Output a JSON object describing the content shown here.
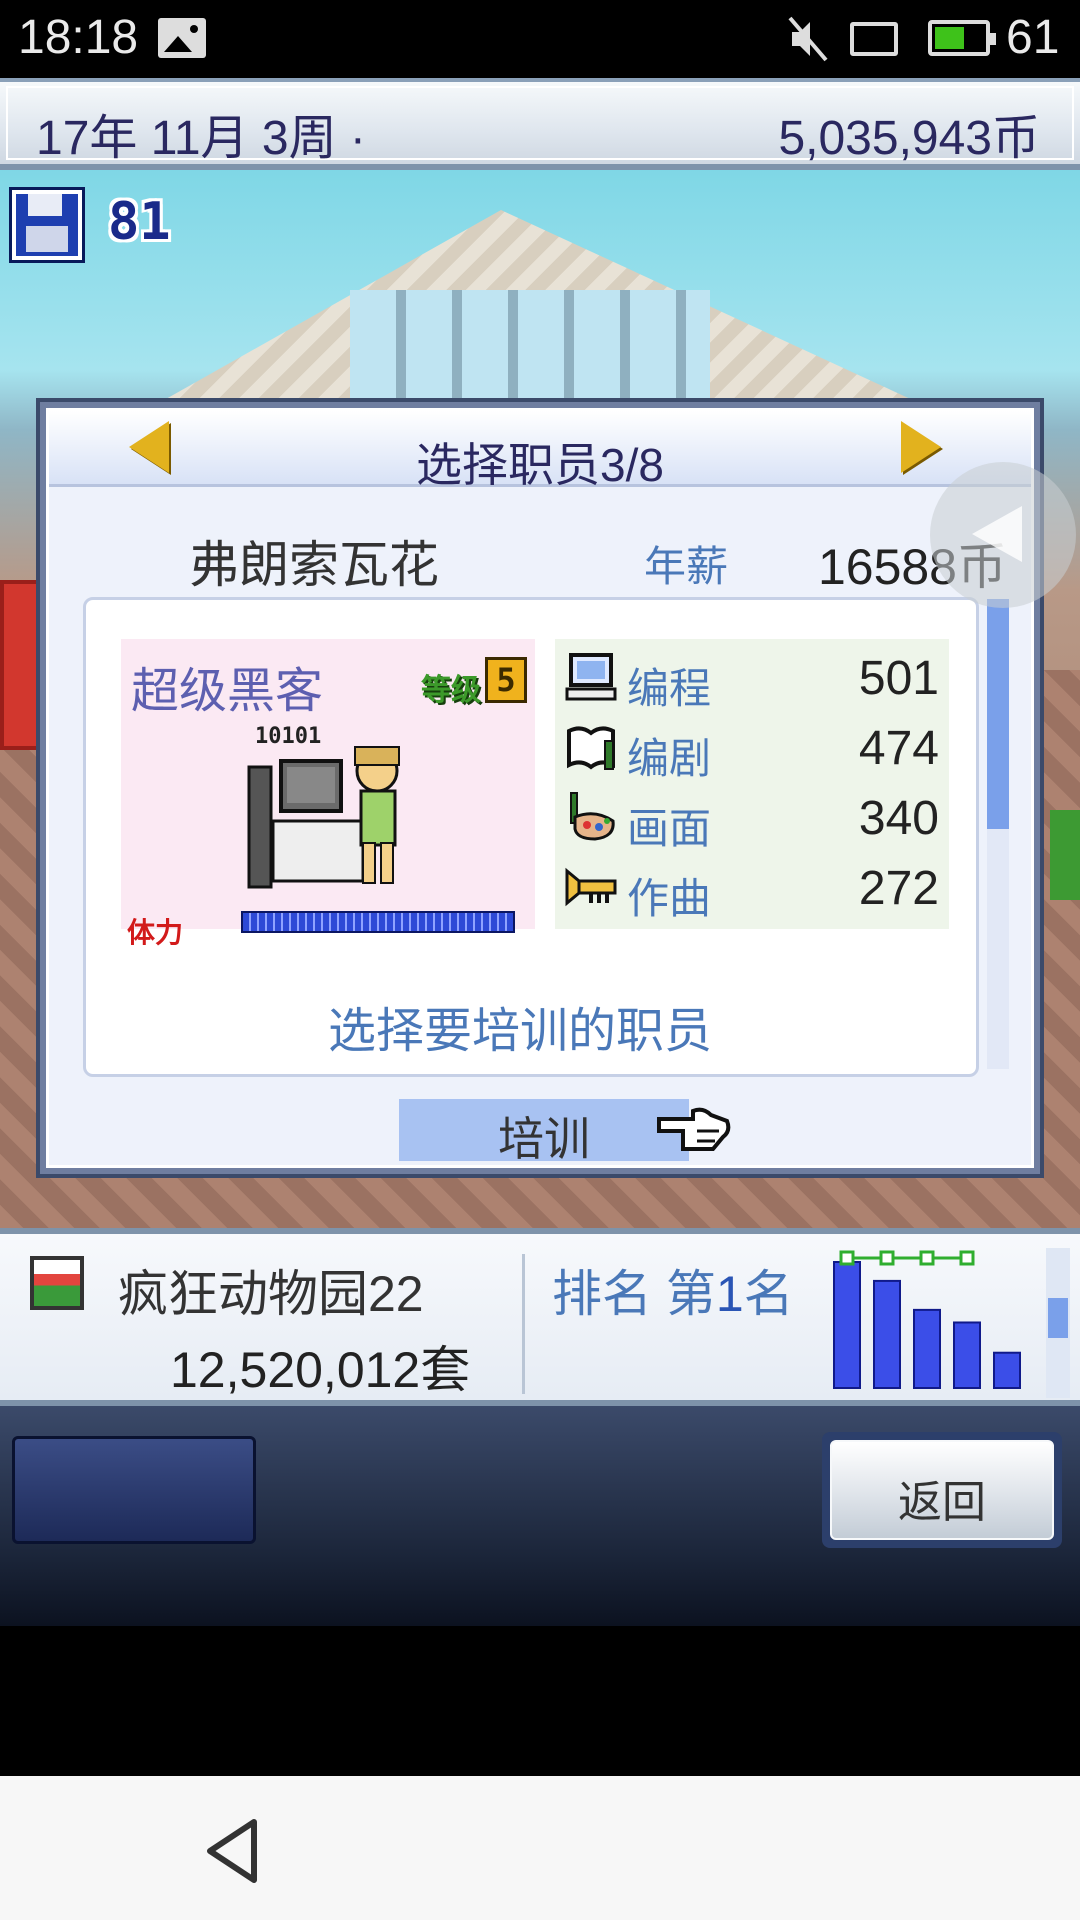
{
  "status_bar": {
    "time": "18:18",
    "battery_level": "61",
    "battery_fraction": 0.61
  },
  "top_bar": {
    "date": "17年 11月 3周 ·",
    "money": "5,035,943币"
  },
  "scene": {
    "save_count": "81"
  },
  "dialog": {
    "title": "选择职员3/8",
    "employee_name": "弗朗索瓦花",
    "salary_label": "年薪",
    "salary_value": "16588币",
    "job_title": "超级黑客",
    "level_label": "等级",
    "level_value": "5",
    "stamina_label": "体力",
    "stamina_fraction": 1.0,
    "sprite_label": "10101",
    "stats": [
      {
        "icon": "computer-icon",
        "label": "编程",
        "value": "501"
      },
      {
        "icon": "book-icon",
        "label": "编剧",
        "value": "474"
      },
      {
        "icon": "palette-icon",
        "label": "画面",
        "value": "340"
      },
      {
        "icon": "trumpet-icon",
        "label": "作曲",
        "value": "272"
      }
    ],
    "hint": "选择要培训的职员",
    "train_button": "培训"
  },
  "info_bar": {
    "game_title": "疯狂动物园22",
    "sales": "12,520,012套",
    "rank_prefix": "排名 第",
    "rank_number": "1",
    "rank_suffix": "名",
    "rank_bars": [
      1.0,
      0.85,
      0.62,
      0.52,
      0.28
    ]
  },
  "controls": {
    "return_button": "返回"
  },
  "colors": {
    "accent_blue": "#4a78b8",
    "title_navy": "#2a2860",
    "arrow_gold": "#e2b21e",
    "stamina_red": "#d21a1a",
    "level_green": "#3c9a2a"
  }
}
